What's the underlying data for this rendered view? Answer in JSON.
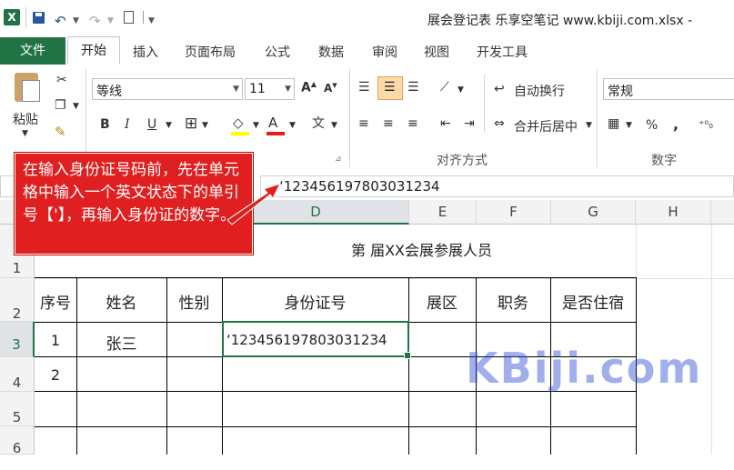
{
  "window": {
    "title": "展会登记表 乐享空笔记 www.kbiji.com.xlsx -",
    "quick_access_icons": [
      "excel-logo-icon",
      "save-icon",
      "undo-icon",
      "redo-icon",
      "new-file-icon",
      "customize-icon"
    ]
  },
  "tabs": [
    {
      "label": "文件"
    },
    {
      "label": "开始"
    },
    {
      "label": "插入"
    },
    {
      "label": "页面布局"
    },
    {
      "label": "公式"
    },
    {
      "label": "数据"
    },
    {
      "label": "审阅"
    },
    {
      "label": "视图"
    },
    {
      "label": "开发工具"
    }
  ],
  "ribbon": {
    "clipboard": {
      "paste_label": "粘贴"
    },
    "font": {
      "name": "等线",
      "size": "11"
    },
    "alignment": {
      "wrap_text": "自动换行",
      "merge_center": "合并后居中",
      "group_label": "对齐方式"
    },
    "number": {
      "format": "常规",
      "group_label": "数字",
      "percent": "%",
      "comma": ","
    }
  },
  "formula_bar": {
    "value": "‘123456197803031234"
  },
  "columns": [
    "D",
    "E",
    "F",
    "G",
    "H"
  ],
  "rows": [
    "1",
    "2",
    "3",
    "4",
    "5",
    "6"
  ],
  "sheet": {
    "title": "第  届XX会展参展人员",
    "headers": [
      "序号",
      "姓名",
      "性别",
      "身份证号",
      "展区",
      "职务",
      "是否住宿"
    ],
    "data": [
      {
        "no": "1",
        "name": "张三",
        "id": "‘123456197803031234"
      },
      {
        "no": "2"
      }
    ]
  },
  "callout": {
    "text": "在输入身份证号码前，先在单元格中输入一个英文状态下的单引号【'】，再输入身份证的数字。"
  },
  "watermark": {
    "text": "KBiji.com"
  },
  "colors": {
    "accent": "#217346",
    "callout": "#e02020",
    "watermark": "#2f4fd6"
  }
}
